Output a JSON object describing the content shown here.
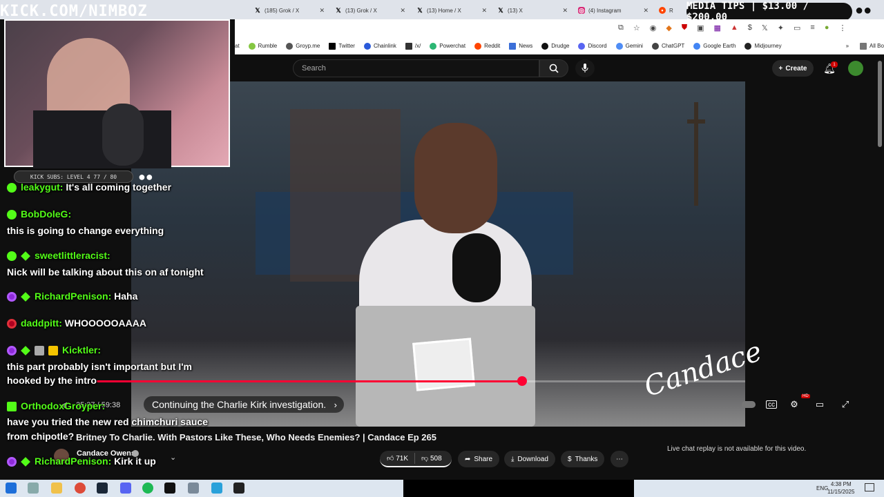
{
  "tabs": [
    {
      "label": "(185) Grok / X",
      "icon": "x-icon"
    },
    {
      "label": "(13) Grok / X",
      "icon": "x-icon"
    },
    {
      "label": "(13) Home / X",
      "icon": "x-icon"
    },
    {
      "label": "(13) X",
      "icon": "x-icon"
    },
    {
      "label": "(4) Instagram",
      "icon": "instagram-icon"
    },
    {
      "label": "R",
      "icon": "reddit-icon"
    }
  ],
  "bookmarks": [
    "at",
    "Rumble",
    "Groyp.me",
    "Twitter",
    "Chainlink",
    "/x/",
    "Powerchat",
    "Reddit",
    "News",
    "Drudge",
    "Discord",
    "Gemini",
    "ChatGPT",
    "Google Earth",
    "Midjourney"
  ],
  "all_bookmarks": "All Bookmarks",
  "overlay": {
    "kick_banner": "KICK.COM/NIMBOZ",
    "subs": "KICK SUBS: LEVEL 4 77 / 80",
    "media_tips": "MEDIA TIPS | $13.00 / $200.00"
  },
  "chat": [
    {
      "user": "leakygut:",
      "msg": "It's all coming together"
    },
    {
      "user": "BobDoleG:",
      "msg": "this is going to change everything"
    },
    {
      "user": "sweetlittleracist:",
      "msg": "Nick will be talking about this on af tonight"
    },
    {
      "user": "RichardPenison:",
      "msg": "Haha"
    },
    {
      "user": "daddpitt:",
      "msg": "WHOOOOOAAAA"
    },
    {
      "user": "Kicktler:",
      "msg": "this part probably isn't important but I'm",
      "msg2": "hooked by the intro"
    },
    {
      "user": "OrthodoxGroyper:",
      "msg": "have you tried the new red chimchuri sauce",
      "msg2": "from chipotle?"
    },
    {
      "user": "RichardPenison:",
      "msg": "Kirk it up"
    }
  ],
  "youtube": {
    "search_placeholder": "Search",
    "create": "Create",
    "notif_count": "1",
    "time": "25:37 / 59:38",
    "chapter": "Continuing the Charlie Kirk investigation.",
    "hd": "HD",
    "signature": "Candace",
    "title": "Britney To Charlie. With Pastors Like These, Who Needs Enemies? | Candace Ep 265",
    "channel": "Candace Owens",
    "likes": "71K",
    "dislikes": "508",
    "share": "Share",
    "download": "Download",
    "thanks": "Thanks",
    "replay_note": "Live chat replay is not available for this video."
  },
  "taskbar": {
    "lang": "ENG",
    "time": "4:38 PM",
    "date": "11/15/2025"
  }
}
